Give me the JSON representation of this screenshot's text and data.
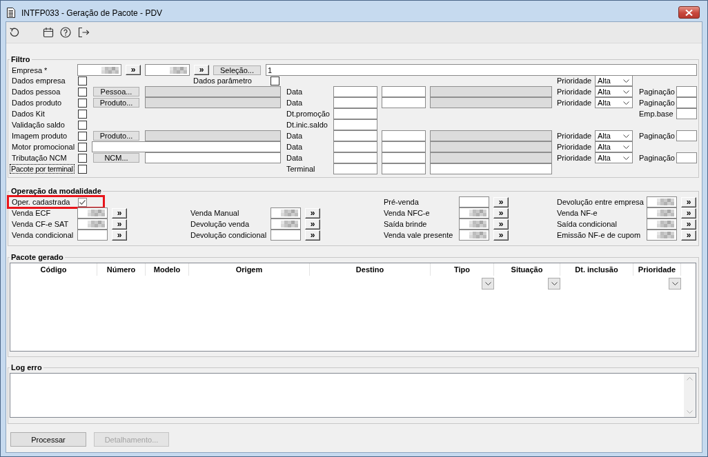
{
  "window": {
    "title": "INTFP033 - Geração de Pacote - PDV"
  },
  "filter": {
    "title": "Filtro",
    "rows": [
      {
        "kind": "company",
        "label": "Empresa *",
        "ranges": [
          {
            "blurred": true,
            "lookup": "»"
          },
          {
            "blurred": true,
            "lookup": "»"
          }
        ],
        "button": "Seleção...",
        "value": "1"
      },
      {
        "kind": "option",
        "label": "Dados empresa",
        "checked": false,
        "focused": false,
        "param": {
          "label": "Dados parâmetro",
          "checked": false
        },
        "priority": {
          "label": "Prioridade",
          "value": "Alta"
        }
      },
      {
        "kind": "lookup",
        "label": "Dados pessoa",
        "checked": false,
        "focused": false,
        "button": "Pessoa...",
        "field": {
          "disabled": true
        },
        "dates": {
          "label": "Data",
          "fields": [
            {
              "disabled": false
            },
            {
              "disabled": false
            },
            {
              "disabled": true
            }
          ]
        },
        "priority": {
          "label": "Prioridade",
          "value": "Alta"
        },
        "extra": {
          "label": "Paginação"
        }
      },
      {
        "kind": "lookup",
        "label": "Dados produto",
        "checked": false,
        "focused": false,
        "button": "Produto...",
        "field": {
          "disabled": true
        },
        "dates": {
          "label": "Data",
          "fields": [
            {
              "disabled": false
            },
            {
              "disabled": false
            },
            {
              "disabled": true
            }
          ]
        },
        "priority": {
          "label": "Prioridade",
          "value": "Alta"
        },
        "extra": {
          "label": "Paginação"
        }
      },
      {
        "kind": "option",
        "label": "Dados Kit",
        "checked": false,
        "focused": false,
        "dates": {
          "label": "Dt.promoção",
          "fields": [
            {
              "disabled": false
            }
          ]
        },
        "extra": {
          "label": "Emp.base"
        }
      },
      {
        "kind": "option",
        "label": "Validação saldo",
        "checked": false,
        "focused": false,
        "dates": {
          "label": "Dt.inic.saldo",
          "fields": [
            {
              "disabled": false
            }
          ]
        }
      },
      {
        "kind": "lookup",
        "label": "Imagem produto",
        "checked": false,
        "focused": false,
        "button": "Produto...",
        "field": {
          "disabled": true
        },
        "dates": {
          "label": "Data",
          "fields": [
            {
              "disabled": false
            },
            {
              "disabled": false
            },
            {
              "disabled": true
            }
          ]
        },
        "priority": {
          "label": "Prioridade",
          "value": "Alta"
        },
        "extra": {
          "label": "Paginação"
        }
      },
      {
        "kind": "input",
        "label": "Motor promocional",
        "checked": false,
        "focused": false,
        "field": {
          "disabled": false
        },
        "dates": {
          "label": "Data",
          "fields": [
            {
              "disabled": false
            },
            {
              "disabled": false
            },
            {
              "disabled": true
            }
          ]
        },
        "priority": {
          "label": "Prioridade",
          "value": "Alta"
        }
      },
      {
        "kind": "lookup",
        "label": "Tributação NCM",
        "checked": false,
        "focused": false,
        "button": "NCM...",
        "field": {
          "disabled": false
        },
        "dates": {
          "label": "Data",
          "fields": [
            {
              "disabled": false
            },
            {
              "disabled": false
            },
            {
              "disabled": true
            }
          ]
        },
        "priority": {
          "label": "Prioridade",
          "value": "Alta"
        },
        "extra": {
          "label": "Paginação"
        }
      },
      {
        "kind": "option",
        "label": "Pacote por terminal",
        "checked": false,
        "focused": true,
        "dates": {
          "label": "Terminal",
          "fields": [
            {
              "disabled": false
            },
            {
              "disabled": false
            },
            {
              "disabled": false
            }
          ]
        }
      }
    ]
  },
  "operations": {
    "title": "Operação da modalidade",
    "registered": {
      "label": "Oper. cadastrada",
      "checked": true,
      "highlighted": true
    },
    "columns": [
      [
        {
          "label": "Venda ECF",
          "blurred": true,
          "lookup": "»"
        },
        {
          "label": "Venda CF-e SAT",
          "blurred": true,
          "lookup": "»"
        },
        {
          "label": "Venda condicional",
          "blurred": false,
          "lookup": "»"
        }
      ],
      [
        {
          "label": "Venda Manual",
          "blurred": true,
          "lookup": "»"
        },
        {
          "label": "Devolução venda",
          "blurred": true,
          "lookup": "»"
        },
        {
          "label": "Devolução condicional",
          "blurred": false,
          "lookup": "»"
        }
      ],
      [
        {
          "label": "Pré-venda",
          "blurred": false,
          "lookup": "»"
        },
        {
          "label": "Venda NFC-e",
          "blurred": true,
          "lookup": "»"
        },
        {
          "label": "Saída brinde",
          "blurred": true,
          "lookup": "»"
        },
        {
          "label": "Venda vale presente",
          "blurred": true,
          "lookup": "»"
        }
      ],
      [
        {
          "label": "Devolução entre empresa",
          "blurred": true,
          "lookup": "»"
        },
        {
          "label": "Venda NF-e",
          "blurred": true,
          "lookup": "»"
        },
        {
          "label": "Saída condicional",
          "blurred": true,
          "lookup": "»"
        },
        {
          "label": "Emissão NF-e de cupom",
          "blurred": true,
          "lookup": "»"
        }
      ]
    ]
  },
  "packages": {
    "title": "Pacote gerado",
    "columns": [
      {
        "label": "Código",
        "dropdown": false
      },
      {
        "label": "Número",
        "dropdown": false
      },
      {
        "label": "Modelo",
        "dropdown": false
      },
      {
        "label": "Origem",
        "dropdown": false
      },
      {
        "label": "Destino",
        "dropdown": false
      },
      {
        "label": "Tipo",
        "dropdown": true
      },
      {
        "label": "Situação",
        "dropdown": true
      },
      {
        "label": "Dt. inclusão",
        "dropdown": false
      },
      {
        "label": "Prioridade",
        "dropdown": true
      }
    ]
  },
  "log": {
    "title": "Log erro"
  },
  "buttons": [
    {
      "label": "Processar",
      "disabled": false
    },
    {
      "label": "Detalhamento...",
      "disabled": true
    }
  ]
}
